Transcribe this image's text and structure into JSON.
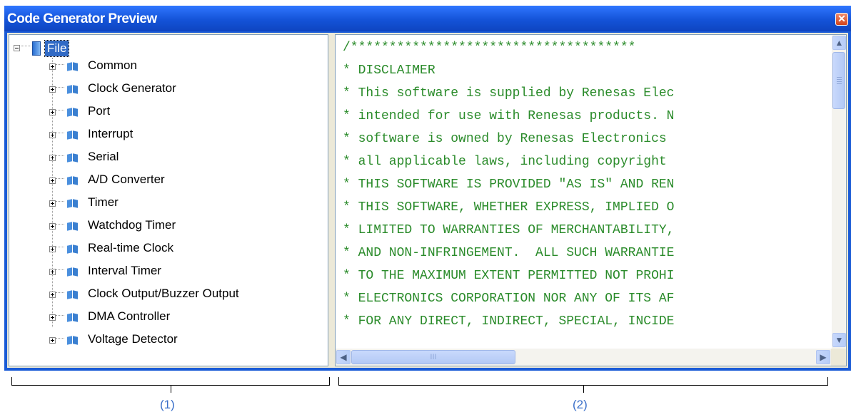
{
  "window": {
    "title": "Code Generator Preview",
    "close_glyph": "✕"
  },
  "tree": {
    "root_label": "File",
    "items": [
      {
        "label": "Common"
      },
      {
        "label": "Clock Generator"
      },
      {
        "label": "Port"
      },
      {
        "label": "Interrupt"
      },
      {
        "label": "Serial"
      },
      {
        "label": "A/D Converter"
      },
      {
        "label": "Timer"
      },
      {
        "label": "Watchdog Timer"
      },
      {
        "label": "Real-time Clock"
      },
      {
        "label": "Interval Timer"
      },
      {
        "label": "Clock Output/Buzzer Output"
      },
      {
        "label": "DMA Controller"
      },
      {
        "label": "Voltage Detector"
      }
    ]
  },
  "code": {
    "color": "#2a8b2a",
    "lines": [
      "/*************************************",
      "* DISCLAIMER",
      "* This software is supplied by Renesas Elec",
      "* intended for use with Renesas products. N",
      "* software is owned by Renesas Electronics",
      "* all applicable laws, including copyright",
      "* THIS SOFTWARE IS PROVIDED \"AS IS\" AND REN",
      "* THIS SOFTWARE, WHETHER EXPRESS, IMPLIED O",
      "* LIMITED TO WARRANTIES OF MERCHANTABILITY,",
      "* AND NON-INFRINGEMENT.  ALL SUCH WARRANTIE",
      "* TO THE MAXIMUM EXTENT PERMITTED NOT PROHI",
      "* ELECTRONICS CORPORATION NOR ANY OF ITS AF",
      "* FOR ANY DIRECT, INDIRECT, SPECIAL, INCIDE"
    ]
  },
  "scrollbars": {
    "up_glyph": "▲",
    "down_glyph": "▼",
    "left_glyph": "◀",
    "right_glyph": "▶",
    "grip_glyph": "III"
  },
  "callouts": {
    "left": "(1)",
    "right": "(2)"
  },
  "colors": {
    "titlebar": "#1a5bd6",
    "callout": "#3a6fc9",
    "selection": "#316ac5"
  }
}
